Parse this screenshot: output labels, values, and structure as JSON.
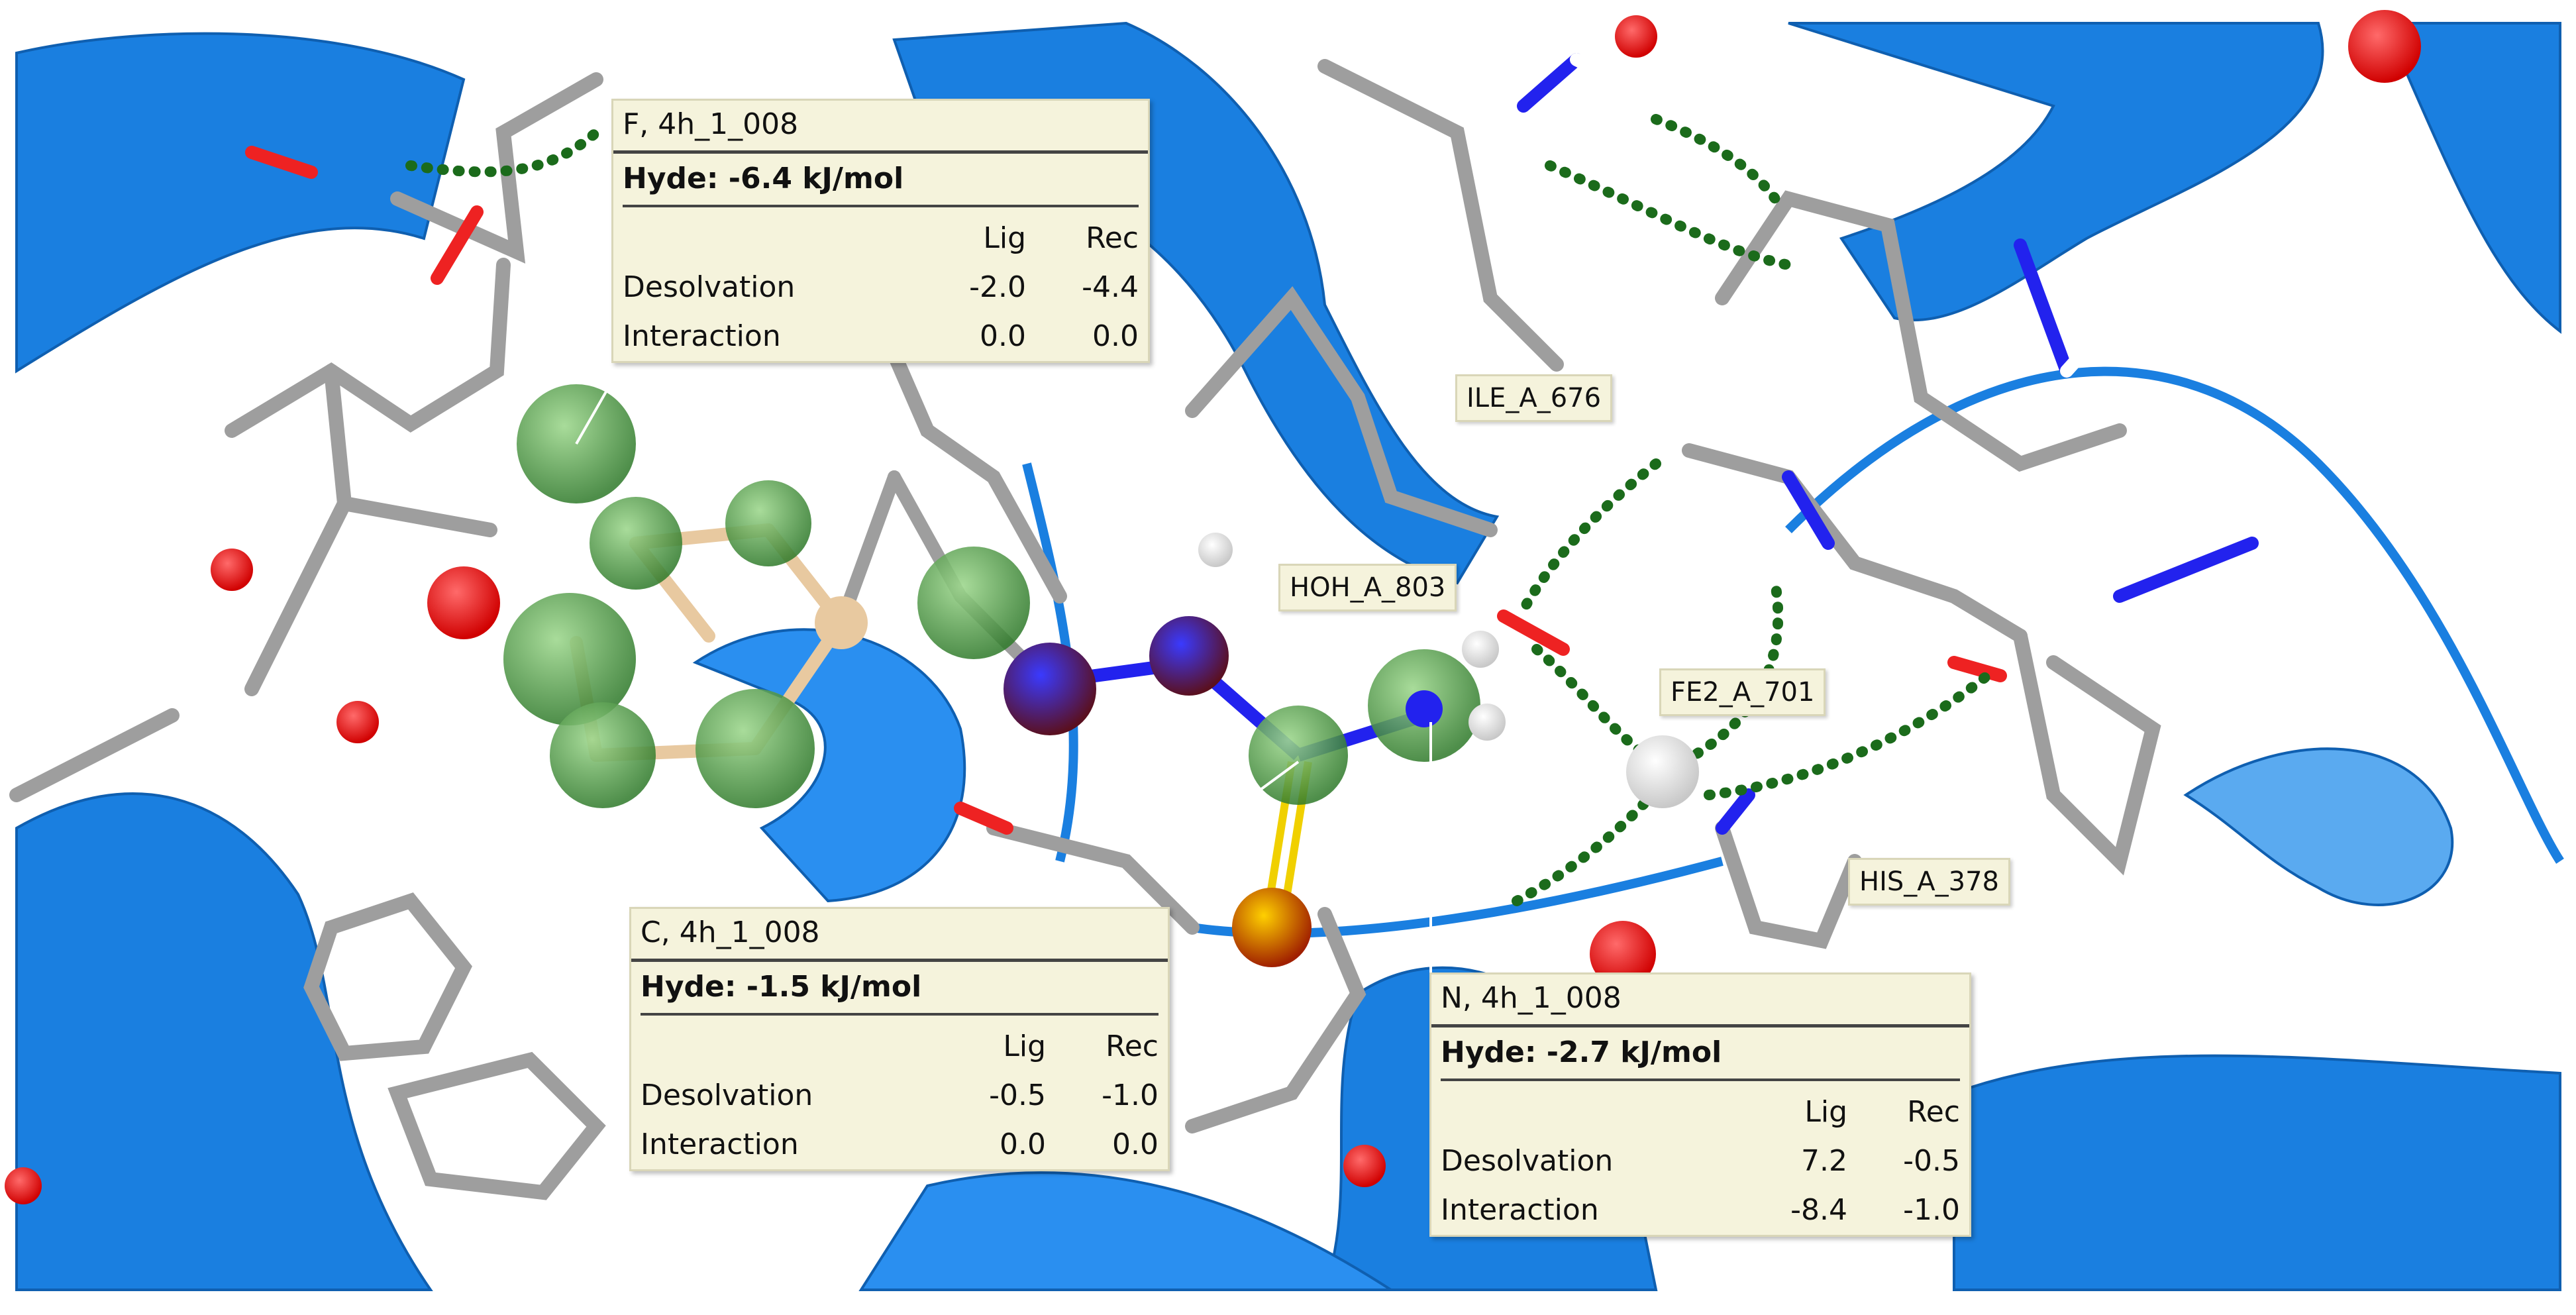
{
  "colors": {
    "ribbon": "#1a7fe0",
    "carbon": "#9e9e9e",
    "oxygen": "#ee2222",
    "nitrogen": "#2222ee",
    "hydrogen": "#ffffff",
    "hbond": "#1b6b1b",
    "tooltip_bg": "#f5f3dc",
    "ligand_sphere": "#3f9a3a"
  },
  "tooltips": [
    {
      "title": "F, 4h_1_008",
      "hyde": "Hyde: -6.4 kJ/mol",
      "col_lig": "Lig",
      "col_rec": "Rec",
      "rows": [
        {
          "label": "Desolvation",
          "lig": "-2.0",
          "rec": "-4.4"
        },
        {
          "label": "Interaction",
          "lig": "0.0",
          "rec": "0.0"
        }
      ]
    },
    {
      "title": "C, 4h_1_008",
      "hyde": "Hyde: -1.5 kJ/mol",
      "col_lig": "Lig",
      "col_rec": "Rec",
      "rows": [
        {
          "label": "Desolvation",
          "lig": "-0.5",
          "rec": "-1.0"
        },
        {
          "label": "Interaction",
          "lig": "0.0",
          "rec": "0.0"
        }
      ]
    },
    {
      "title": "N, 4h_1_008",
      "hyde": "Hyde: -2.7 kJ/mol",
      "col_lig": "Lig",
      "col_rec": "Rec",
      "rows": [
        {
          "label": "Desolvation",
          "lig": "7.2",
          "rec": "-0.5"
        },
        {
          "label": "Interaction",
          "lig": "-8.4",
          "rec": "-1.0"
        }
      ]
    }
  ],
  "residue_labels": [
    "ILE_A_676",
    "HOH_A_803",
    "FE2_A_701",
    "HIS_A_378"
  ]
}
